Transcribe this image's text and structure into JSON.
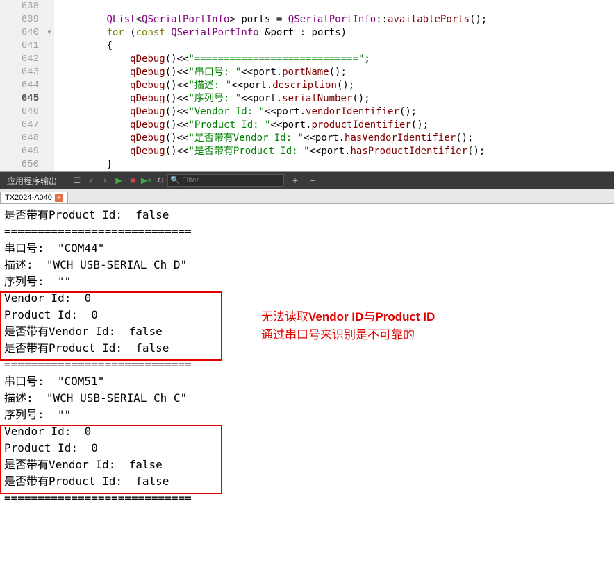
{
  "code": {
    "lines": [
      {
        "n": "638",
        "indent": "",
        "fold": "",
        "html": ""
      },
      {
        "n": "639",
        "indent": "        ",
        "fold": "",
        "tokens": [
          [
            "kw-type",
            "QList"
          ],
          [
            "op",
            "<"
          ],
          [
            "kw-type",
            "QSerialPortInfo"
          ],
          [
            "op",
            "> "
          ],
          [
            "plain",
            "ports "
          ],
          [
            "op",
            "= "
          ],
          [
            "kw-type",
            "QSerialPortInfo"
          ],
          [
            "op",
            "::"
          ],
          [
            "ident",
            "availablePorts"
          ],
          [
            "op",
            "();"
          ]
        ]
      },
      {
        "n": "640",
        "indent": "        ",
        "fold": "▾",
        "tokens": [
          [
            "kw-ctrl",
            "for"
          ],
          [
            "op",
            " ("
          ],
          [
            "kw-ctrl",
            "const"
          ],
          [
            "plain",
            " "
          ],
          [
            "kw-type",
            "QSerialPortInfo"
          ],
          [
            "plain",
            " "
          ],
          [
            "op",
            "&"
          ],
          [
            "plain",
            "port "
          ],
          [
            "op",
            ": "
          ],
          [
            "plain",
            "ports"
          ],
          [
            "op",
            ")"
          ]
        ]
      },
      {
        "n": "641",
        "indent": "        ",
        "fold": "",
        "tokens": [
          [
            "op",
            "{"
          ]
        ]
      },
      {
        "n": "642",
        "indent": "            ",
        "fold": "",
        "tokens": [
          [
            "ident",
            "qDebug"
          ],
          [
            "op",
            "()"
          ],
          [
            "op",
            "<<"
          ],
          [
            "str",
            "\"============================\""
          ],
          [
            "op",
            ";"
          ]
        ]
      },
      {
        "n": "643",
        "indent": "            ",
        "fold": "",
        "tokens": [
          [
            "ident",
            "qDebug"
          ],
          [
            "op",
            "()"
          ],
          [
            "op",
            "<<"
          ],
          [
            "str",
            "\"串口号: \""
          ],
          [
            "op",
            "<<"
          ],
          [
            "plain",
            "port."
          ],
          [
            "ident",
            "portName"
          ],
          [
            "op",
            "();"
          ]
        ]
      },
      {
        "n": "644",
        "indent": "            ",
        "fold": "",
        "tokens": [
          [
            "ident",
            "qDebug"
          ],
          [
            "op",
            "()"
          ],
          [
            "op",
            "<<"
          ],
          [
            "str",
            "\"描述: \""
          ],
          [
            "op",
            "<<"
          ],
          [
            "plain",
            "port."
          ],
          [
            "ident",
            "description"
          ],
          [
            "op",
            "();"
          ]
        ]
      },
      {
        "n": "645",
        "indent": "            ",
        "fold": "",
        "active": true,
        "tokens": [
          [
            "ident",
            "qDebug"
          ],
          [
            "op",
            "()"
          ],
          [
            "op",
            "<<"
          ],
          [
            "str",
            "\"序列号: \""
          ],
          [
            "op",
            "<<"
          ],
          [
            "plain",
            "port."
          ],
          [
            "ident",
            "serialNumber"
          ],
          [
            "op",
            "();"
          ]
        ]
      },
      {
        "n": "646",
        "indent": "            ",
        "fold": "",
        "tokens": [
          [
            "ident",
            "qDebug"
          ],
          [
            "op",
            "()"
          ],
          [
            "op",
            "<<"
          ],
          [
            "str",
            "\"Vendor Id: \""
          ],
          [
            "op",
            "<<"
          ],
          [
            "plain",
            "port."
          ],
          [
            "ident",
            "vendorIdentifier"
          ],
          [
            "op",
            "();"
          ]
        ]
      },
      {
        "n": "647",
        "indent": "            ",
        "fold": "",
        "tokens": [
          [
            "ident",
            "qDebug"
          ],
          [
            "op",
            "()"
          ],
          [
            "op",
            "<<"
          ],
          [
            "str",
            "\"Product Id: \""
          ],
          [
            "op",
            "<<"
          ],
          [
            "plain",
            "port."
          ],
          [
            "ident",
            "productIdentifier"
          ],
          [
            "op",
            "();"
          ]
        ]
      },
      {
        "n": "648",
        "indent": "            ",
        "fold": "",
        "tokens": [
          [
            "ident",
            "qDebug"
          ],
          [
            "op",
            "()"
          ],
          [
            "op",
            "<<"
          ],
          [
            "str",
            "\"是否带有Vendor Id: \""
          ],
          [
            "op",
            "<<"
          ],
          [
            "plain",
            "port."
          ],
          [
            "ident",
            "hasVendorIdentifier"
          ],
          [
            "op",
            "();"
          ]
        ]
      },
      {
        "n": "649",
        "indent": "            ",
        "fold": "",
        "tokens": [
          [
            "ident",
            "qDebug"
          ],
          [
            "op",
            "()"
          ],
          [
            "op",
            "<<"
          ],
          [
            "str",
            "\"是否带有Product Id: \""
          ],
          [
            "op",
            "<<"
          ],
          [
            "plain",
            "port."
          ],
          [
            "ident",
            "hasProductIdentifier"
          ],
          [
            "op",
            "();"
          ]
        ]
      },
      {
        "n": "650",
        "indent": "        ",
        "fold": "",
        "tokens": [
          [
            "op",
            "}"
          ]
        ]
      }
    ]
  },
  "toolbar": {
    "label": "应用程序输出",
    "filter_placeholder": "Filter"
  },
  "tab": {
    "title": "TX2024-A040"
  },
  "output": {
    "lines": [
      "是否带有Product Id:  false",
      "============================",
      "串口号:  \"COM44\"",
      "描述:  \"WCH USB-SERIAL Ch D\"",
      "序列号:  \"\"",
      "Vendor Id:  0",
      "Product Id:  0",
      "是否带有Vendor Id:  false",
      "是否带有Product Id:  false",
      "============================",
      "串口号:  \"COM51\"",
      "描述:  \"WCH USB-SERIAL Ch C\"",
      "序列号:  \"\"",
      "Vendor Id:  0",
      "Product Id:  0",
      "是否带有Vendor Id:  false",
      "是否带有Product Id:  false",
      "============================"
    ]
  },
  "annotation": {
    "line1_a": "无法读取",
    "line1_b": "Vendor ID",
    "line1_c": "与",
    "line1_d": "Product ID",
    "line2": "通过串口号来识别是不可靠的"
  }
}
